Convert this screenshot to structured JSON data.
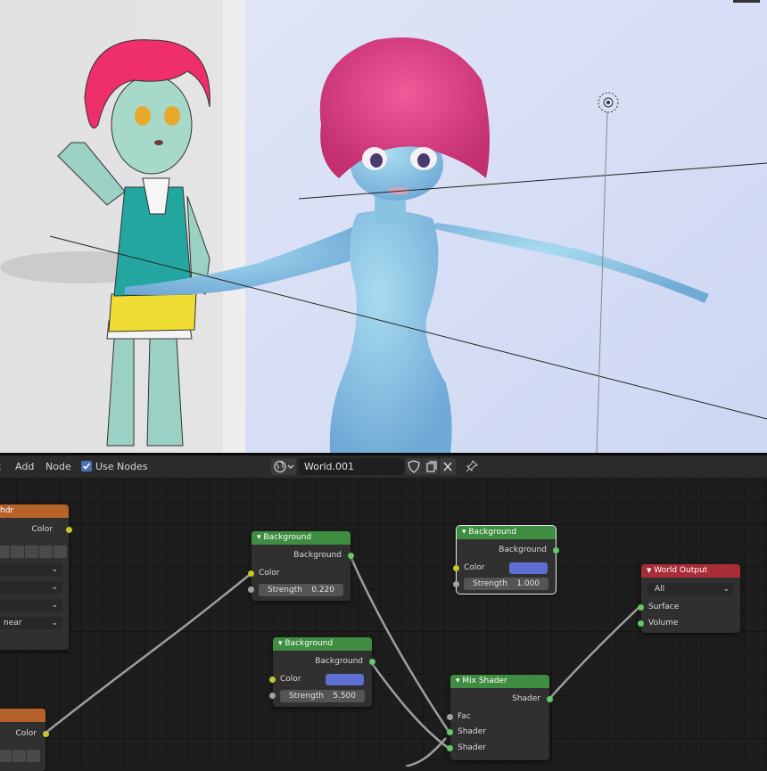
{
  "header": {
    "menu_add": "Add",
    "menu_node": "Node",
    "use_nodes_label": "Use Nodes",
    "world_name": "World.001"
  },
  "nodes": {
    "env_texture": {
      "title": "hdr",
      "output_color": "Color",
      "dropdown_last": "near"
    },
    "env_texture_2": {
      "output_color": "Color"
    },
    "bg1": {
      "title": "Background",
      "output": "Background",
      "input_color": "Color",
      "strength_label": "Strength",
      "strength_value": "0.220"
    },
    "bg2": {
      "title": "Background",
      "output": "Background",
      "input_color": "Color",
      "strength_label": "Strength",
      "strength_value": "1.000"
    },
    "bg3": {
      "title": "Background",
      "output": "Background",
      "input_color": "Color",
      "strength_label": "Strength",
      "strength_value": "5.500"
    },
    "mix": {
      "title": "Mix Shader",
      "output": "Shader",
      "input_fac": "Fac",
      "input_shader1": "Shader",
      "input_shader2": "Shader"
    },
    "output": {
      "title": "World Output",
      "target": "All",
      "input_surface": "Surface",
      "input_volume": "Volume"
    }
  },
  "colors": {
    "background_color_swatch": "#5d6fd2",
    "node_header_shader": "#3e8d41",
    "node_header_output": "#a82d36",
    "node_header_texture": "#b8622b"
  }
}
